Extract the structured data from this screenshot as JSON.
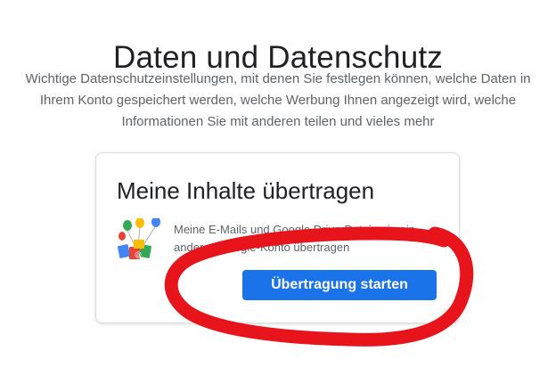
{
  "section": {
    "title": "Daten und Datenschutz",
    "description": "Wichtige Datenschutzeinstellungen, mit denen Sie festlegen können, welche Daten in Ihrem Konto gespeichert werden, welche Werbung Ihnen angezeigt wird, welche Informationen Sie mit anderen teilen und vieles mehr"
  },
  "card": {
    "title": "Meine Inhalte übertragen",
    "description": "Meine E-Mails und Google Drive-Dateien in ein anderes Google-Konto übertragen",
    "button_label": "Übertragung starten",
    "icon": "content-transfer-icon"
  },
  "colors": {
    "button": "#1a73e8",
    "annotation": "#e8141c"
  }
}
